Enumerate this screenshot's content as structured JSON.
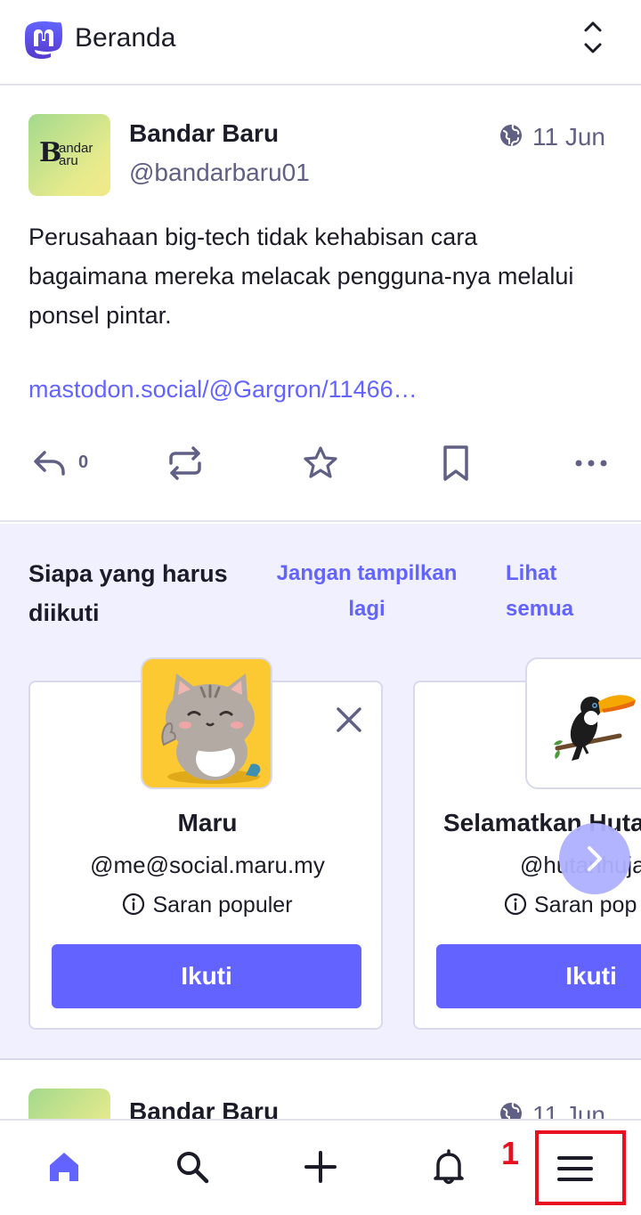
{
  "header": {
    "title": "Beranda",
    "logo_icon": "mastodon-logo-icon",
    "expand_icon": "chevron-up-down-icon"
  },
  "post": {
    "avatar_text_main": "B",
    "avatar_text_top": "andar",
    "avatar_text_bottom": "aru",
    "display_name": "Bandar Baru",
    "handle": "@bandarbaru01",
    "visibility_icon": "globe-icon",
    "date": "11 Jun",
    "text": "Perusahaan big-tech tidak kehabisan cara bagaimana mereka melacak pengguna-nya melalui ponsel pintar.",
    "link": "mastodon.social/@Gargron/11466…",
    "reply_count": "0",
    "actions": [
      "reply-icon",
      "boost-icon",
      "star-icon",
      "bookmark-icon",
      "more-icon"
    ]
  },
  "suggestions": {
    "title": "Siapa yang harus diikuti",
    "dismiss": "Jangan tampilkan lagi",
    "see_all": "Lihat semua",
    "cards": [
      {
        "name": "Maru",
        "handle": "@me@social.maru.my",
        "reason": "Saran populer",
        "follow": "Ikuti"
      },
      {
        "name": "Selamatkan Huta",
        "handle": "@hutanhuja",
        "reason": "Saran pop",
        "follow": "Ikuti"
      }
    ]
  },
  "peek_post": {
    "display_name": "Bandar Baru",
    "date": "11 Jun"
  },
  "bottom_nav": {
    "items": [
      "home-icon",
      "search-icon",
      "compose-icon",
      "bell-icon",
      "menu-icon"
    ]
  },
  "annotation": {
    "number": "1",
    "color": "#e8101e"
  },
  "colors": {
    "accent": "#6364ff",
    "muted": "#606085",
    "suggest_bg": "#f0f0ff"
  }
}
